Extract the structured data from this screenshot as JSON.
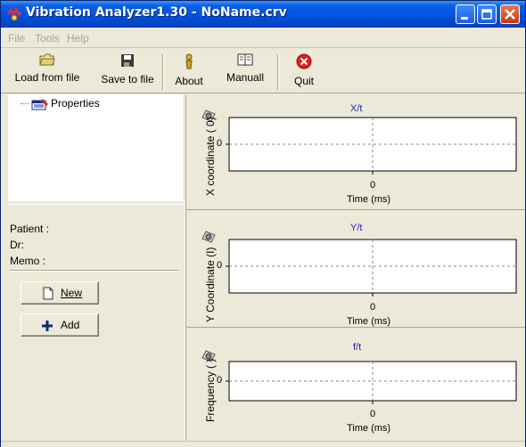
{
  "window": {
    "title": "Vibration Analyzer1.30 - NoName.crv",
    "minimize_icon": "minimize-icon",
    "maximize_icon": "maximize-icon",
    "close_icon": "close-icon",
    "title_bar_color": "#0054E3"
  },
  "menu": {
    "items": [
      "File",
      "Tools",
      "Help"
    ]
  },
  "toolbar": {
    "load_label": "Load from file",
    "save_label": "Save to file",
    "about_label": "About",
    "manual_label": "Manuall",
    "quit_label": "Quit"
  },
  "tree": {
    "root_label": "Properties"
  },
  "info": {
    "patient_label": "Patient :",
    "doctor_label": "Dr:",
    "memo_label": "Memo :",
    "new_button": "New",
    "add_button": "Add"
  },
  "charts": [
    {
      "title": "X/t",
      "ylabel": "X coordinate ( 0)",
      "ytick": "0",
      "xtick": "0",
      "xlabel": "Time (ms)"
    },
    {
      "title": "Y/t",
      "ylabel": "Y Coordinate (I)",
      "ytick": "0",
      "xtick": "0",
      "xlabel": "Time (ms)"
    },
    {
      "title": "f/t",
      "ylabel": "Frequency ( )",
      "ytick": "0",
      "xtick": "0",
      "xlabel": "Time (ms)"
    }
  ],
  "colors": {
    "chart_title": "#2020C0",
    "chrome": "#ECE9D8",
    "grid_line": "#888888"
  }
}
